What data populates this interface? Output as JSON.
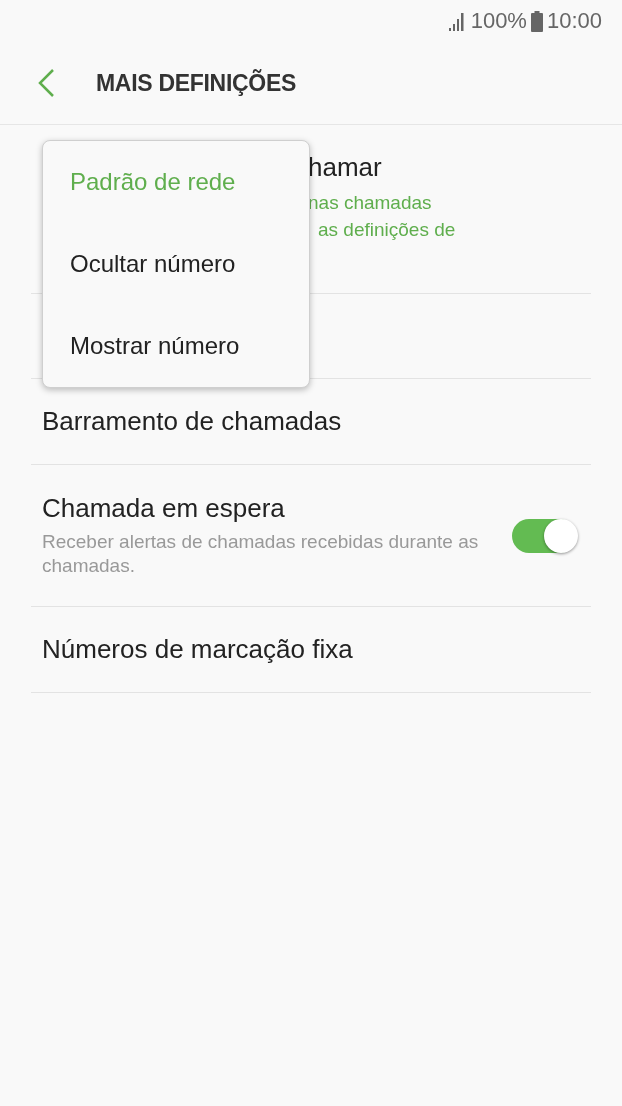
{
  "status_bar": {
    "battery": "100%",
    "time": "10:00"
  },
  "header": {
    "title": "MAIS DEFINIÇÕES"
  },
  "rows": [
    {
      "kind": "partly_covered",
      "title": "hamar",
      "subtitle_lines": [
        "nas chamadas",
        "as definições de"
      ]
    },
    {
      "kind": "covered"
    },
    {
      "kind": "plain",
      "title": "Barramento de chamadas"
    },
    {
      "kind": "switch",
      "title": "Chamada em espera",
      "subtitle": "Receber alertas de chamadas recebidas durante as chamadas.",
      "on": true
    },
    {
      "kind": "plain",
      "title": "Números de marcação fixa"
    }
  ],
  "popup_menu": {
    "items": [
      {
        "label": "Padrão de rede",
        "selected": true
      },
      {
        "label": "Ocultar número",
        "selected": false
      },
      {
        "label": "Mostrar número",
        "selected": false
      }
    ]
  }
}
